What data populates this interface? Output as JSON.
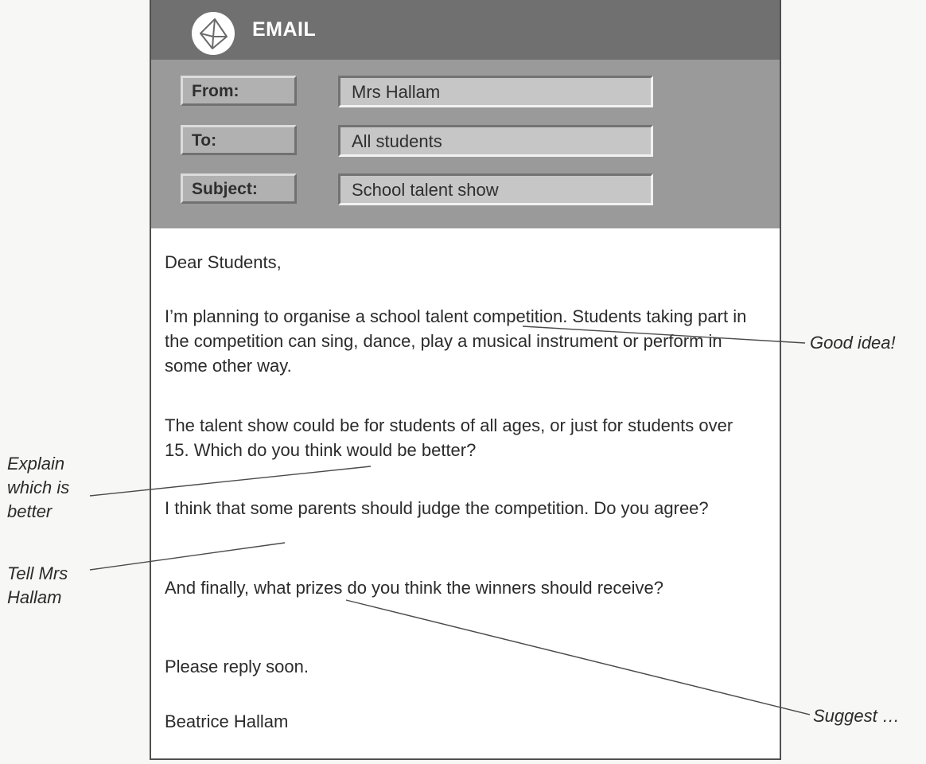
{
  "email": {
    "title": "EMAIL",
    "icon": "envelope-icon",
    "from_label": "From:",
    "from_value": "Mrs Hallam",
    "to_label": "To:",
    "to_value": "All students",
    "subject_label": "Subject:",
    "subject_value": "School talent show",
    "greeting": "Dear Students,",
    "paragraphs": [
      "I’m planning to organise a school talent competition. Students taking part in the competition can sing, dance, play a musical instrument or perform in some other way.",
      "The talent show could be for students of all ages, or just for students over 15. Which do you think would be better?",
      "I think that some parents should judge the competition. Do you agree?",
      "And finally, what prizes do you think the winners should receive?",
      "Please reply soon."
    ],
    "signature": "Beatrice Hallam"
  },
  "annotations": {
    "good_idea": "Good idea!",
    "explain": "Explain which is better",
    "tell": "Tell Mrs Hallam",
    "suggest": "Suggest …"
  }
}
